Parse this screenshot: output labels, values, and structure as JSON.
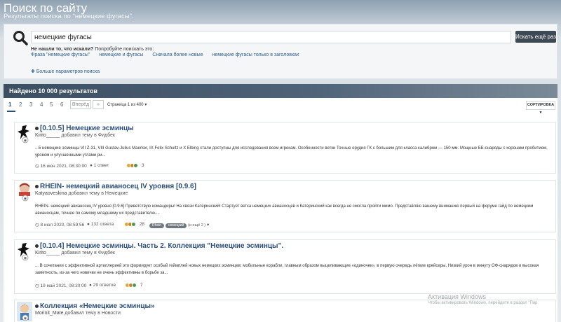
{
  "hero": {
    "title": "Поиск по сайту",
    "subtitle": "Результаты поиска по \"немецкие фугасы\"."
  },
  "search": {
    "query": "немецкие фугасы",
    "button_label": "Искать ещё раз",
    "hint_bold": "Не нашли то, что искали?",
    "hint_rest": "Попробуйте поискать это:",
    "suggestions": [
      "Фраза \"немецкие фугасы\"",
      "немецкие и фугасы",
      "Сначала более новые",
      "немецкие фугасы только в заголовках"
    ],
    "more_params": "Больше параметров поиска"
  },
  "results": {
    "header": "Найдено 10 000 результатов",
    "pages": [
      "1",
      "2",
      "3",
      "4",
      "5",
      "6"
    ],
    "next_label": "Вперёд",
    "last_label": "»",
    "page_of": "Страница 1 из 400",
    "sort_label": "СОРТИРОВКА"
  },
  "items": [
    {
      "title": "[0.10.5] Немецкие эсминцы",
      "author": "Kirito_____",
      "meta_rest": "добавил тему в Фидбек",
      "snippet": "...5 немецкие эсминцы VII Z-31, VIII Gustav-Julius Maerker, IX Felix Schultz и X Elbing стали доступны для исследования всем игрокам. Особенности ветки Точные орудия ГК с большим для класса калибром — 150 мм. Мощные ББ-снаряды с хорошим пробитием, уроном и улучшенными углами ри...",
      "date": "16 июн 2021, 08:30:00",
      "replies": "1 ответ",
      "reactions": "3",
      "tags": []
    },
    {
      "title": "RHEIN- немецкий авианосец IV уровня [0.9.6]",
      "author": "Katyaoveskina",
      "meta_rest": "добавил тему в Немецкие",
      "snippet": "RHEIN- немецкий авианосец IV уровня [0.9.6] Приветствую командиры! На связи Катеринский! Стартует ветка немецких авианосцев и Катеринский как всегда не смогла пройти мимо. Представляю вашему вниманию первый на форуме гайд по немецким авианосцам, точнее по самому младшему их представителю-...",
      "date": "8 июл 2020, 08:59:56",
      "replies": "132 ответа",
      "reactions": "28",
      "tags": [
        "Rhein",
        "немецкий"
      ],
      "more_tags": "(и ещё 2 )"
    },
    {
      "title": "[0.10.4] Немецкие эсминцы. Часть 2. Коллекция \"Немецкие эсминцы\".",
      "author": "Kirito_____",
      "meta_rest": "добавил тему в Фидбек",
      "snippet": "... В сочетании с эффективной артиллерией это формирует особый геймплей новых немецких эсминцев: мобильные корабли, главным образом выцеливающие «одиночек», в первую очередь лёгкие крейсеры. Низкий урон в минуту ОФ-снарядов и высокая заметность, из-за чего новички не очень эффективны в борьбе за...",
      "date": "19 май 2021, 08:30:00",
      "replies": "29 ответов",
      "reactions": "7",
      "tags": []
    },
    {
      "title": "Коллекция «Немецкие эсминцы»",
      "author": "Morinit_Mate",
      "meta_rest": "добавил тему в Новости",
      "snippet": "",
      "date": "",
      "replies": "",
      "reactions": "",
      "tags": []
    }
  ],
  "windows": {
    "line1": "Активация Windows",
    "line2": "Чтобы активировать Windows, перейдите в раздел \"Пар"
  },
  "colors": {
    "link": "#2a4e7a",
    "header_bar": "#3b4e62",
    "button": "#3d4a55",
    "accent_green": "#4a9b4e"
  }
}
